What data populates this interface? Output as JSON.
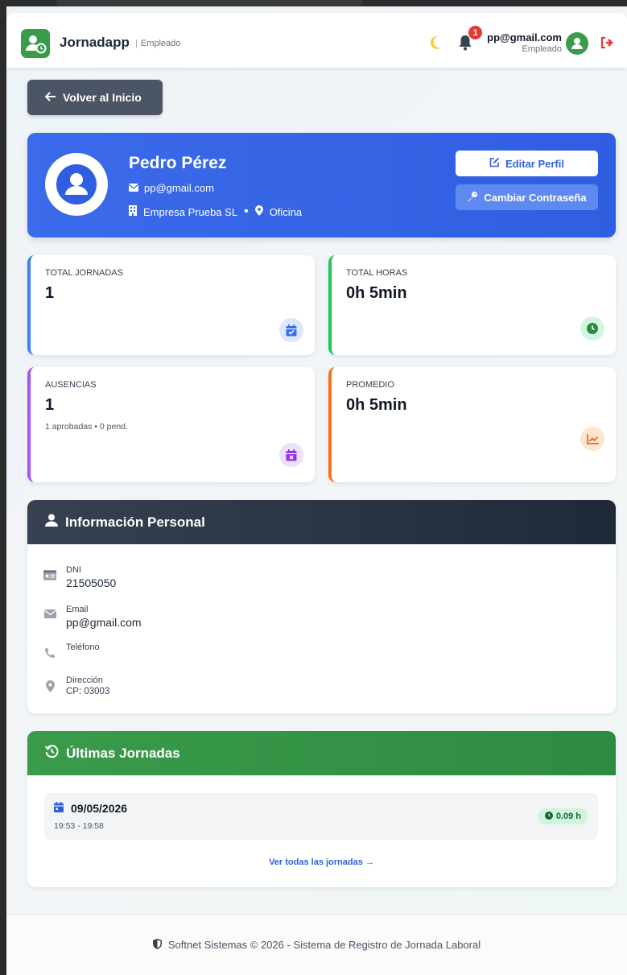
{
  "header": {
    "app_name": "Jornadapp",
    "app_role": "Empleado",
    "notifications_count": "1",
    "user_email": "pp@gmail.com",
    "user_role": "Empleado"
  },
  "back_button": {
    "label": "Volver al Inicio"
  },
  "profile": {
    "name": "Pedro Pérez",
    "email": "pp@gmail.com",
    "company": "Empresa Prueba SL",
    "separator": "•",
    "location": "Oficina",
    "edit_label": "Editar Perfil",
    "password_label": "Cambiar Contraseña"
  },
  "stats": {
    "total_jornadas": {
      "label": "TOTAL JORNADAS",
      "value": "1"
    },
    "total_horas": {
      "label": "TOTAL HORAS",
      "value": "0h 5min"
    },
    "ausencias": {
      "label": "AUSENCIAS",
      "value": "1",
      "sub": "1 aprobadas • 0 pend."
    },
    "promedio": {
      "label": "PROMEDIO",
      "value": "0h 5min"
    }
  },
  "personal_info": {
    "title": "Información Personal",
    "dni_label": "DNI",
    "dni_value": "21505050",
    "email_label": "Email",
    "email_value": "pp@gmail.com",
    "phone_label": "Teléfono",
    "address_label": "Dirección",
    "address_value": "CP: 03003"
  },
  "last_jornadas": {
    "title": "Últimas Jornadas",
    "items": [
      {
        "date": "09/05/2026",
        "time": "19:53 - 19:58",
        "hours": "0.09 h"
      }
    ],
    "see_all": "Ver todas las jornadas →"
  },
  "footer": {
    "text": "Softnet Sistemas © 2026 - Sistema de Registro de Jornada Laboral"
  },
  "colors": {
    "brand_green": "#3a9b4a",
    "profile_blue": "#2f5fe0",
    "dark_header": "#1f2937",
    "danger": "#e53935"
  }
}
